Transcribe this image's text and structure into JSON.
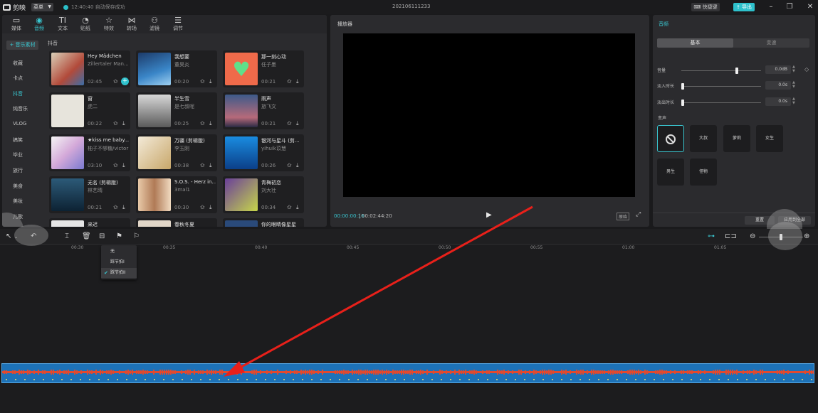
{
  "titlebar": {
    "app_name": "剪映",
    "menu_label": "菜单",
    "save_status": "12:40:40 自动保存成功",
    "project_title": "202106111233",
    "shortcut_label": "快捷键",
    "export_label": "导出",
    "accent_color": "#2ec1cc"
  },
  "tool_tabs": [
    {
      "label": "媒体",
      "icon": "media-icon"
    },
    {
      "label": "音频",
      "icon": "audio-icon"
    },
    {
      "label": "文本",
      "icon": "text-icon"
    },
    {
      "label": "贴纸",
      "icon": "sticker-icon"
    },
    {
      "label": "特效",
      "icon": "effects-icon"
    },
    {
      "label": "转场",
      "icon": "transition-icon"
    },
    {
      "label": "滤镜",
      "icon": "filter-icon"
    },
    {
      "label": "调节",
      "icon": "adjust-icon"
    }
  ],
  "sidebar": {
    "music_material": "+ 音乐素材",
    "items": [
      "收藏",
      "卡点",
      "抖音",
      "纯音乐",
      "VLOG",
      "搞笑",
      "毕业",
      "旅行",
      "美食",
      "美妆",
      "儿歌"
    ]
  },
  "section_label": "抖音",
  "songs": [
    {
      "title": "Hey Mädchen",
      "artist": "Zillertaler Man...",
      "duration": "02:45"
    },
    {
      "title": "我想要",
      "artist": "董昊炎",
      "duration": "00:20"
    },
    {
      "title": "那一刻心动",
      "artist": "任子墨",
      "duration": "00:21"
    },
    {
      "title": "窗",
      "artist": "虎二",
      "duration": "00:22"
    },
    {
      "title": "半生雪",
      "artist": "是七叔呢",
      "duration": "00:25"
    },
    {
      "title": "雨声",
      "artist": "旅飞文",
      "duration": "00:21"
    },
    {
      "title": "★kiss me baby...",
      "artist": "柚子不够糖/victor",
      "duration": "03:10"
    },
    {
      "title": "万疆 (剪辑版)",
      "artist": "李玉刚",
      "duration": "00:38"
    },
    {
      "title": "银河与星斗 (剪...",
      "artist": "yihuik苡慧",
      "duration": "00:26"
    },
    {
      "title": "无名 (剪辑版)",
      "artist": "林艺晴",
      "duration": "00:21"
    },
    {
      "title": "S.O.S. - Herz in...",
      "artist": "3mal1",
      "duration": "00:30"
    },
    {
      "title": "青梅初恋",
      "artist": "刘大壮",
      "duration": "00:34"
    },
    {
      "title": "来迟",
      "artist": "",
      "duration": ""
    },
    {
      "title": "春秋冬夏",
      "artist": "",
      "duration": ""
    },
    {
      "title": "你的眼睛像星星",
      "artist": "",
      "duration": ""
    }
  ],
  "player": {
    "title": "播放器",
    "time_current": "00:00:00:16",
    "time_total": "00:02:44:20",
    "ratio_label": "原始"
  },
  "audio_panel": {
    "title": "音频",
    "tab_basic": "基本",
    "tab_speed": "变速",
    "volume_label": "音量",
    "volume_value": "0.0dB",
    "volume_level_fraction": 0.7,
    "fade_in_label": "淡入时长",
    "fade_in_value": "0.0s",
    "fade_out_label": "淡出时长",
    "fade_out_value": "0.0s",
    "voice_change_label": "变声",
    "voices": [
      "无",
      "大叔",
      "萝莉",
      "女生",
      "男生",
      "怪物"
    ],
    "reset_label": "重置",
    "apply_all_label": "应用到全部"
  },
  "timeline": {
    "ruler_labels": [
      "00:30",
      "00:35",
      "00:40",
      "00:45",
      "00:50",
      "00:55",
      "01:00",
      "01:05"
    ],
    "snap_menu": [
      "无",
      "踩节拍I",
      "踩节拍II"
    ],
    "snap_menu_checked": "踩节拍II",
    "zoom_level_fraction": 0.5
  },
  "colors": {
    "accent": "#39c5cf",
    "track_blue": "#1d72b8",
    "waveform": "#e04a2f",
    "arrow": "#e8201a"
  }
}
